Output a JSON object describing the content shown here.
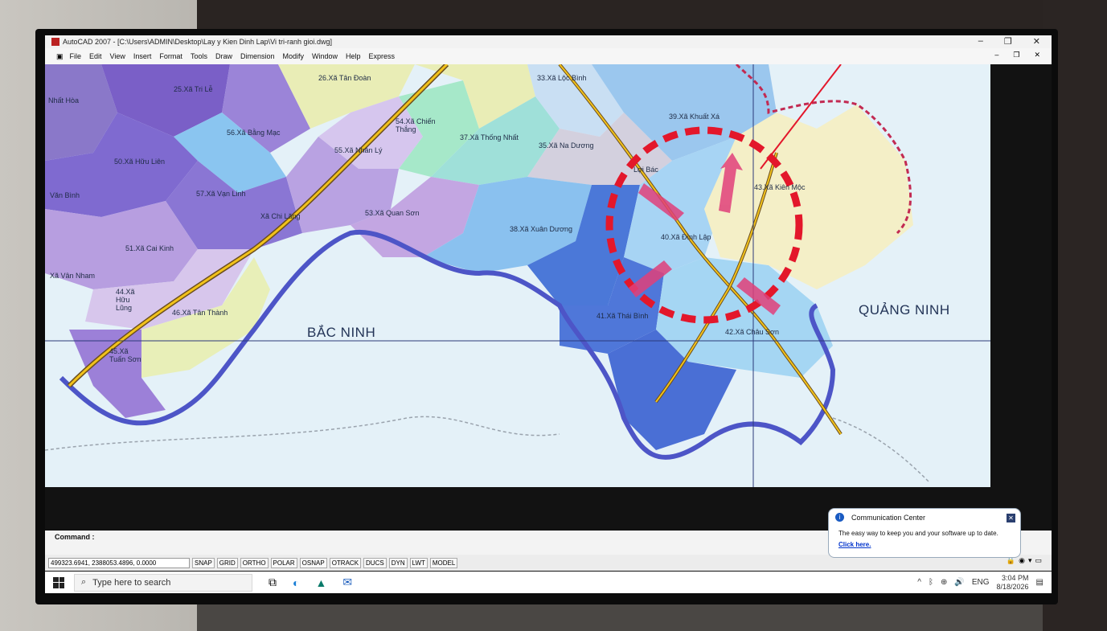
{
  "window": {
    "title": "AutoCAD 2007 - [C:\\Users\\ADMIN\\Desktop\\Lay y Kien Dinh Lap\\Vi tri-ranh gioi.dwg]",
    "controls": [
      "–",
      "❐",
      "✕"
    ]
  },
  "menu": [
    "File",
    "Edit",
    "View",
    "Insert",
    "Format",
    "Tools",
    "Draw",
    "Dimension",
    "Modify",
    "Window",
    "Help",
    "Express"
  ],
  "map": {
    "provinces": [
      "BẮC NINH",
      "QUẢNG NINH"
    ],
    "communes": [
      "26.Xã Tân Đoàn",
      "33.Xã Lộc Bình",
      "25.Xã Tri Lễ",
      "56.Xã Bằng Mạc",
      "54.Xã Chiến Thắng",
      "37.Xã Thống Nhất",
      "39.Xã Khuất Xá",
      "35.Xã Na Dương",
      "55.Xã Nhân Lý",
      "50.Xã Hữu Liên",
      "Lợi Bác",
      "43.Xã Kiên Mộc",
      "57.Xã Vạn Linh",
      "53.Xã Quan Sơn",
      "Văn Bình",
      "Xã Chi Lăng",
      "38.Xã Xuân Dương",
      "40.Xã Đình Lập",
      "51.Xã Cai Kinh",
      "Xã Vân Nham",
      "44.Xã Hữu Lũng",
      "46.Xã Tân Thành",
      "41.Xã Thái Bình",
      "42.Xã Châu Sơn",
      "45.Xã Tuấn Sơn",
      "Nhất Hòa"
    ]
  },
  "command": {
    "label": "Command :"
  },
  "status": {
    "coords": "499323.6941, 2388053.4896, 0.0000",
    "toggles": [
      "SNAP",
      "GRID",
      "ORTHO",
      "POLAR",
      "OSNAP",
      "OTRACK",
      "DUCS",
      "DYN",
      "LWT",
      "MODEL"
    ]
  },
  "balloon": {
    "title": "Communication Center",
    "text": "The easy way to keep you and your software up to date.",
    "link": "Click here."
  },
  "taskbar": {
    "search_placeholder": "Type here to search",
    "language": "ENG",
    "time": "3:04 PM",
    "date": "8/18/2026"
  },
  "colors": {
    "map_background": "#e4f1f8",
    "border_violet": "#4d55c7",
    "highlight_red": "#e3172b",
    "road_yellow": "#f2c21a"
  }
}
